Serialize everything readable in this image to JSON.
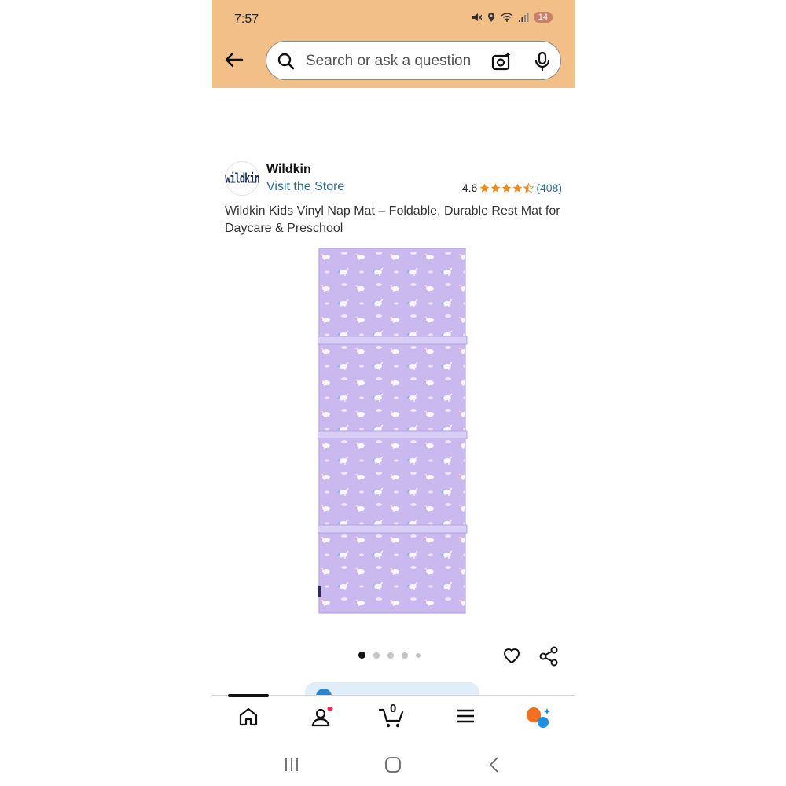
{
  "status_bar": {
    "time": "7:57",
    "battery": "14"
  },
  "search": {
    "placeholder": "Search or ask a question"
  },
  "brand": {
    "logo_text": "wildkin",
    "name": "Wildkin",
    "store_link": "Visit the Store"
  },
  "rating": {
    "value": "4.6",
    "stars": 4.5,
    "count": "(408)"
  },
  "product": {
    "title": "Wildkin Kids Vinyl Nap Mat – Foldable, Durable Rest Mat for Daycare & Preschool"
  },
  "carousel": {
    "total": 5,
    "active": 1
  },
  "cart": {
    "count": "0"
  },
  "nav": {
    "items": [
      "home-icon",
      "account-icon",
      "cart-icon",
      "menu-icon",
      "rufus-icon"
    ]
  },
  "colors": {
    "header": "#f1bf87",
    "link": "#2e6b8f",
    "star": "#f08a1c",
    "mat": "#c7b7ec"
  }
}
